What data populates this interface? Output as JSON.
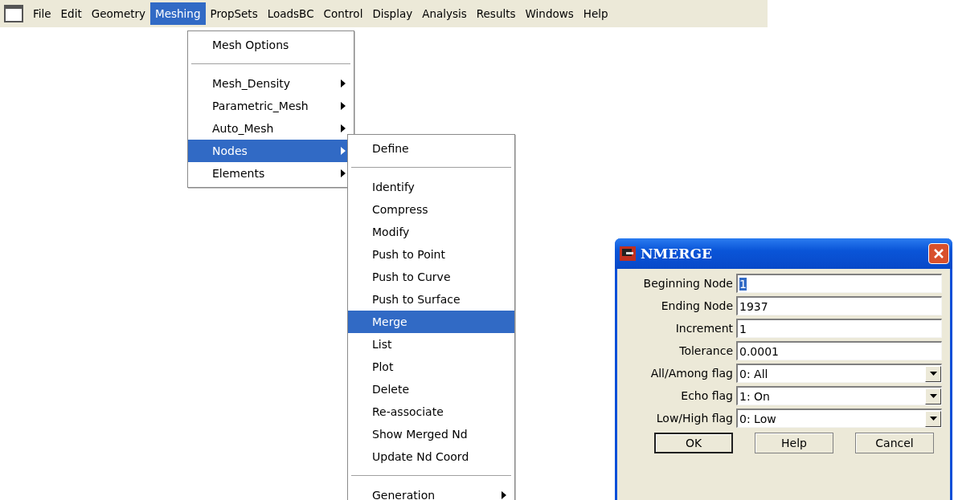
{
  "menubar": {
    "items": [
      {
        "label": "File",
        "selected": false
      },
      {
        "label": "Edit",
        "selected": false
      },
      {
        "label": "Geometry",
        "selected": false
      },
      {
        "label": "Meshing",
        "selected": true
      },
      {
        "label": "PropSets",
        "selected": false
      },
      {
        "label": "LoadsBC",
        "selected": false
      },
      {
        "label": "Control",
        "selected": false
      },
      {
        "label": "Display",
        "selected": false
      },
      {
        "label": "Analysis",
        "selected": false
      },
      {
        "label": "Results",
        "selected": false
      },
      {
        "label": "Windows",
        "selected": false
      },
      {
        "label": "Help",
        "selected": false
      }
    ]
  },
  "meshing_menu": {
    "groups": [
      [
        {
          "label": "Mesh Options",
          "has_submenu": false,
          "selected": false
        }
      ],
      [
        {
          "label": "Mesh_Density",
          "has_submenu": true,
          "selected": false
        },
        {
          "label": "Parametric_Mesh",
          "has_submenu": true,
          "selected": false
        },
        {
          "label": "Auto_Mesh",
          "has_submenu": true,
          "selected": false
        },
        {
          "label": "Nodes",
          "has_submenu": true,
          "selected": true
        },
        {
          "label": "Elements",
          "has_submenu": true,
          "selected": false
        }
      ]
    ]
  },
  "nodes_submenu": {
    "groups": [
      [
        {
          "label": "Define",
          "has_submenu": false,
          "selected": false
        }
      ],
      [
        {
          "label": "Identify",
          "has_submenu": false,
          "selected": false
        },
        {
          "label": "Compress",
          "has_submenu": false,
          "selected": false
        },
        {
          "label": "Modify",
          "has_submenu": false,
          "selected": false
        },
        {
          "label": "Push to Point",
          "has_submenu": false,
          "selected": false
        },
        {
          "label": "Push to Curve",
          "has_submenu": false,
          "selected": false
        },
        {
          "label": "Push to Surface",
          "has_submenu": false,
          "selected": false
        },
        {
          "label": "Merge",
          "has_submenu": false,
          "selected": true
        },
        {
          "label": "List",
          "has_submenu": false,
          "selected": false
        },
        {
          "label": "Plot",
          "has_submenu": false,
          "selected": false
        },
        {
          "label": "Delete",
          "has_submenu": false,
          "selected": false
        },
        {
          "label": "Re-associate",
          "has_submenu": false,
          "selected": false
        },
        {
          "label": "Show Merged Nd",
          "has_submenu": false,
          "selected": false
        },
        {
          "label": "Update Nd Coord",
          "has_submenu": false,
          "selected": false
        }
      ],
      [
        {
          "label": "Generation",
          "has_submenu": true,
          "selected": false
        }
      ]
    ]
  },
  "dialog": {
    "title": "NMERGE",
    "fields": [
      {
        "label": "Beginning Node",
        "kind": "text",
        "value": "1",
        "highlighted": true
      },
      {
        "label": "Ending Node",
        "kind": "text",
        "value": "1937",
        "highlighted": false
      },
      {
        "label": "Increment",
        "kind": "text",
        "value": "1",
        "highlighted": false
      },
      {
        "label": "Tolerance",
        "kind": "text",
        "value": "0.0001",
        "highlighted": false
      },
      {
        "label": "All/Among flag",
        "kind": "select",
        "value": "0: All",
        "highlighted": false
      },
      {
        "label": "Echo flag",
        "kind": "select",
        "value": "1: On",
        "highlighted": false
      },
      {
        "label": "Low/High flag",
        "kind": "select",
        "value": "0: Low",
        "highlighted": false
      }
    ],
    "buttons": [
      {
        "label": "OK",
        "default": true
      },
      {
        "label": "Help",
        "default": false
      },
      {
        "label": "Cancel",
        "default": false
      }
    ]
  }
}
